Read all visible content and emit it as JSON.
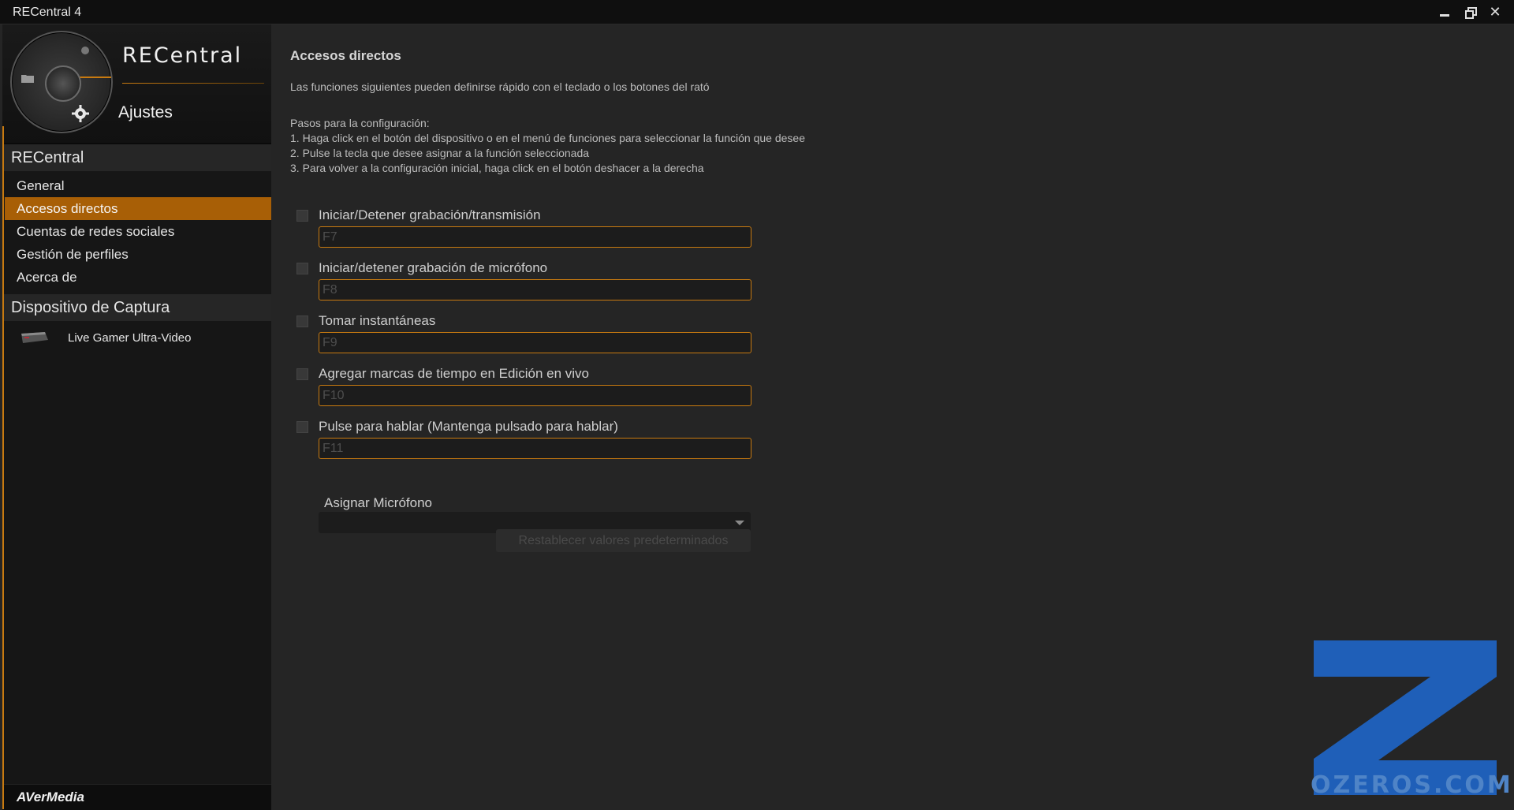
{
  "window": {
    "title": "RECentral 4"
  },
  "header": {
    "brand": "RECentral",
    "section": "Ajustes"
  },
  "sidebar": {
    "group_recentral": "RECentral",
    "items": [
      {
        "label": "General"
      },
      {
        "label": "Accesos directos",
        "active": true
      },
      {
        "label": "Cuentas de redes sociales"
      },
      {
        "label": "Gestión de perfiles"
      },
      {
        "label": "Acerca de"
      }
    ],
    "group_device": "Dispositivo de Captura",
    "device": "Live Gamer Ultra-Video",
    "footer": "AVerMedia"
  },
  "main": {
    "title": "Accesos directos",
    "description": "Las funciones siguientes pueden definirse rápido con el teclado o los botones del rató",
    "steps_title": "Pasos para la configuración:",
    "steps": [
      "1. Haga click en el botón del dispositivo o en el menú de funciones para seleccionar la función que desee",
      "2. Pulse la tecla que desee asignar a la función seleccionada",
      "3. Para volver a la configuración inicial, haga click en el botón deshacer a la derecha"
    ],
    "shortcuts": [
      {
        "label": "Iniciar/Detener grabación/transmisión",
        "key": "F7"
      },
      {
        "label": "Iniciar/detener grabación de micrófono",
        "key": "F8"
      },
      {
        "label": "Tomar instantáneas",
        "key": "F9"
      },
      {
        "label": "Agregar marcas de tiempo en Edición en vivo",
        "key": "F10"
      },
      {
        "label": "Pulse para hablar (Mantenga pulsado para hablar)",
        "key": "F11"
      }
    ],
    "mic_label": "Asignar Micrófono",
    "mic_value": "",
    "reset_label": "Restablecer valores predeterminados"
  },
  "watermark": {
    "text": "OZEROS.COM"
  },
  "colors": {
    "accent": "#c87a10",
    "active_item": "#a85f06",
    "watermark_blue": "#1f5fb8"
  }
}
